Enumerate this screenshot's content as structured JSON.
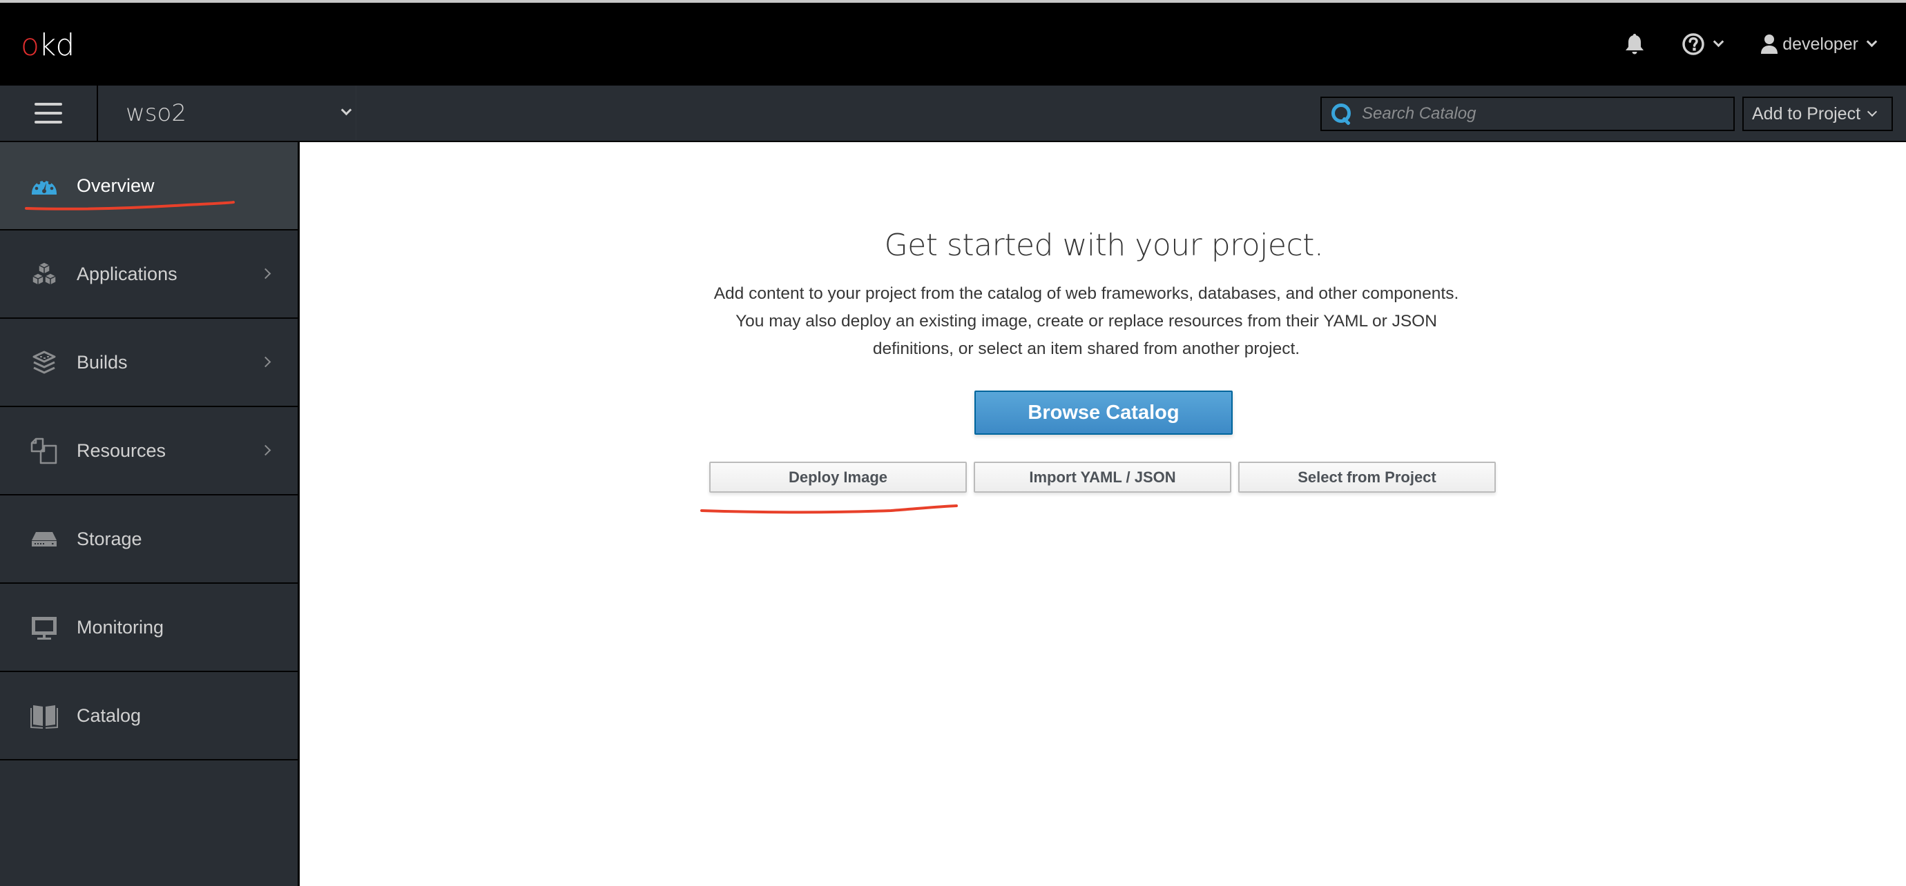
{
  "masthead": {
    "logo_o": "o",
    "logo_rest": "kd",
    "notifications_icon": "bell-icon",
    "help_icon": "question-circle-icon",
    "user_icon": "user-icon",
    "username": "developer"
  },
  "subbar": {
    "menu_icon": "hamburger-icon",
    "project_name": "wso2",
    "search": {
      "placeholder": "Search Catalog",
      "value": "",
      "icon": "search-icon"
    },
    "add_to_project_label": "Add to Project"
  },
  "sidebar": {
    "items": [
      {
        "label": "Overview",
        "icon": "dashboard-icon",
        "active": true,
        "has_submenu": false
      },
      {
        "label": "Applications",
        "icon": "cubes-icon",
        "active": false,
        "has_submenu": true
      },
      {
        "label": "Builds",
        "icon": "build-layers-icon",
        "active": false,
        "has_submenu": true
      },
      {
        "label": "Resources",
        "icon": "files-icon",
        "active": false,
        "has_submenu": true
      },
      {
        "label": "Storage",
        "icon": "storage-icon",
        "active": false,
        "has_submenu": false
      },
      {
        "label": "Monitoring",
        "icon": "monitor-icon",
        "active": false,
        "has_submenu": false
      },
      {
        "label": "Catalog",
        "icon": "book-icon",
        "active": false,
        "has_submenu": false
      }
    ]
  },
  "main": {
    "title": "Get started with your project.",
    "description": "Add content to your project from the catalog of web frameworks, databases, and other components. You may also deploy an existing image, create or replace resources from their YAML or JSON definitions, or select an item shared from another project.",
    "primary_button": "Browse Catalog",
    "secondary_buttons": [
      "Deploy Image",
      "Import YAML / JSON",
      "Select from Project"
    ]
  },
  "colors": {
    "accent": "#39a5dc",
    "logo_red": "#e12e2e",
    "annotation_red": "#e8402a",
    "masthead_bg": "#000000",
    "nav_bg": "#292e34",
    "nav_active_bg": "#393f44"
  }
}
